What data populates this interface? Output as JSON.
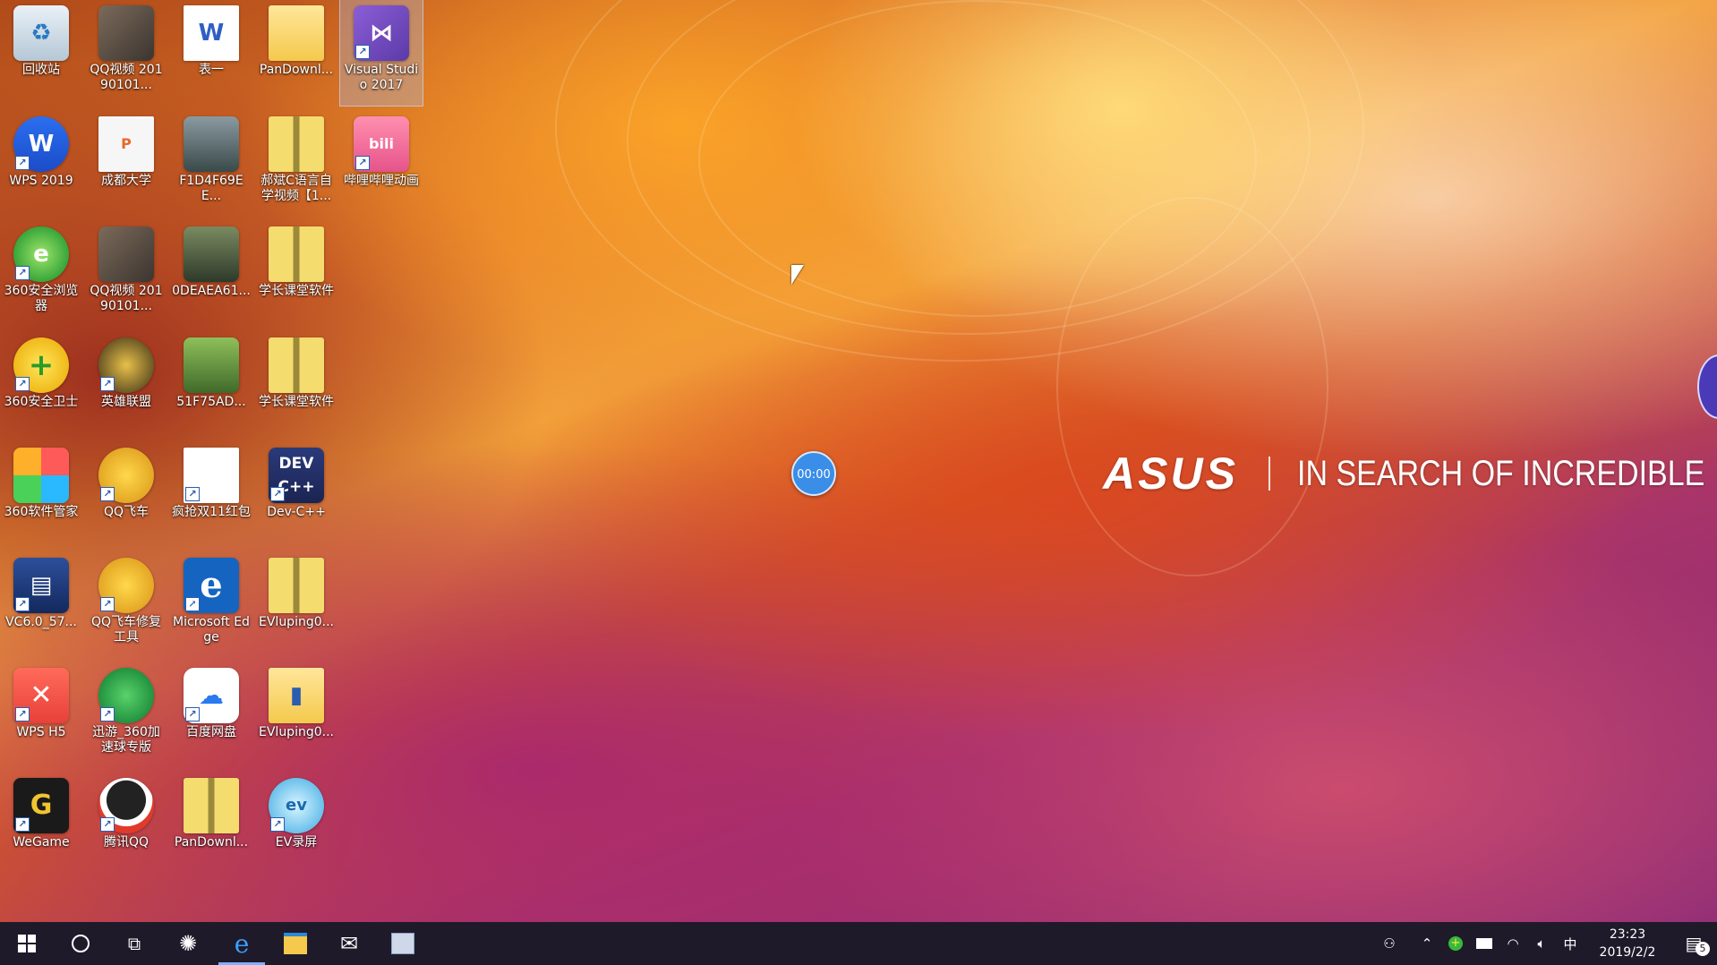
{
  "desktop": {
    "icons": [
      {
        "label": "回收站",
        "glyph": "♻",
        "icon": "recycle-bin-icon"
      },
      {
        "label": "QQ视频 20190101...",
        "glyph": "",
        "icon": "video-thumbnail-icon"
      },
      {
        "label": "表一",
        "glyph": "W",
        "icon": "word-document-icon"
      },
      {
        "label": "PanDownl...",
        "glyph": "",
        "icon": "folder-icon"
      },
      {
        "label": "Visual Studio 2017",
        "glyph": "⋈",
        "icon": "visual-studio-icon"
      },
      {
        "label": "WPS 2019",
        "glyph": "W",
        "icon": "wps-icon"
      },
      {
        "label": "成都大学",
        "glyph": "P",
        "icon": "presentation-file-icon"
      },
      {
        "label": "F1D4F69EE...",
        "glyph": "",
        "icon": "photo-thumbnail-icon"
      },
      {
        "label": "郝斌C语言自学视频【1...",
        "glyph": "",
        "icon": "zip-archive-icon"
      },
      {
        "label": "哔哩哔哩动画",
        "glyph": "bili",
        "icon": "bilibili-icon"
      },
      {
        "label": "360安全浏览器",
        "glyph": "e",
        "icon": "360-browser-icon"
      },
      {
        "label": "QQ视频 20190101...",
        "glyph": "",
        "icon": "video-thumbnail-icon"
      },
      {
        "label": "0DEAEA61...",
        "glyph": "",
        "icon": "photo-thumbnail-icon"
      },
      {
        "label": "学长课堂软件",
        "glyph": "",
        "icon": "zip-archive-icon"
      },
      {
        "label": "360安全卫士",
        "glyph": "+",
        "icon": "360-guard-icon"
      },
      {
        "label": "英雄联盟",
        "glyph": "",
        "icon": "league-of-legends-icon"
      },
      {
        "label": "51F75AD...",
        "glyph": "",
        "icon": "photo-thumbnail-icon"
      },
      {
        "label": "学长课堂软件",
        "glyph": "",
        "icon": "zip-archive-icon"
      },
      {
        "label": "360软件管家",
        "glyph": "",
        "icon": "360-software-manager-icon"
      },
      {
        "label": "QQ飞车",
        "glyph": "",
        "icon": "qq-speed-icon"
      },
      {
        "label": "疯抢双11红包",
        "glyph": "",
        "icon": "blank-file-icon"
      },
      {
        "label": "Dev-C++",
        "glyph": "DEV C++",
        "icon": "dev-cpp-icon"
      },
      {
        "label": "VC6.0_57...",
        "glyph": "▤",
        "icon": "vc6-icon"
      },
      {
        "label": "QQ飞车修复工具",
        "glyph": "",
        "icon": "qq-speed-repair-icon"
      },
      {
        "label": "Microsoft Edge",
        "glyph": "e",
        "icon": "edge-icon"
      },
      {
        "label": "EVluping0...",
        "glyph": "",
        "icon": "zip-archive-icon"
      },
      {
        "label": "WPS H5",
        "glyph": "✕",
        "icon": "wps-h5-icon"
      },
      {
        "label": "迅游_360加速球专版",
        "glyph": "",
        "icon": "xunyou-icon"
      },
      {
        "label": "百度网盘",
        "glyph": "☁",
        "icon": "baidu-netdisk-icon"
      },
      {
        "label": "EVluping0...",
        "glyph": "▮",
        "icon": "ev-folder-icon"
      },
      {
        "label": "WeGame",
        "glyph": "G",
        "icon": "wegame-icon"
      },
      {
        "label": "腾讯QQ",
        "glyph": "",
        "icon": "qq-penguin-icon"
      },
      {
        "label": "PanDownl...",
        "glyph": "",
        "icon": "zip-archive-icon"
      },
      {
        "label": "EV录屏",
        "glyph": "ev",
        "icon": "ev-recorder-icon"
      }
    ],
    "asus_logo": "ASUS",
    "asus_tagline": "IN SEARCH OF INCREDIBLE",
    "timer": "00:00"
  },
  "taskbar": {
    "clock_time": "23:23",
    "clock_date": "2019/2/2",
    "ime": "中",
    "notification_count": "5"
  }
}
